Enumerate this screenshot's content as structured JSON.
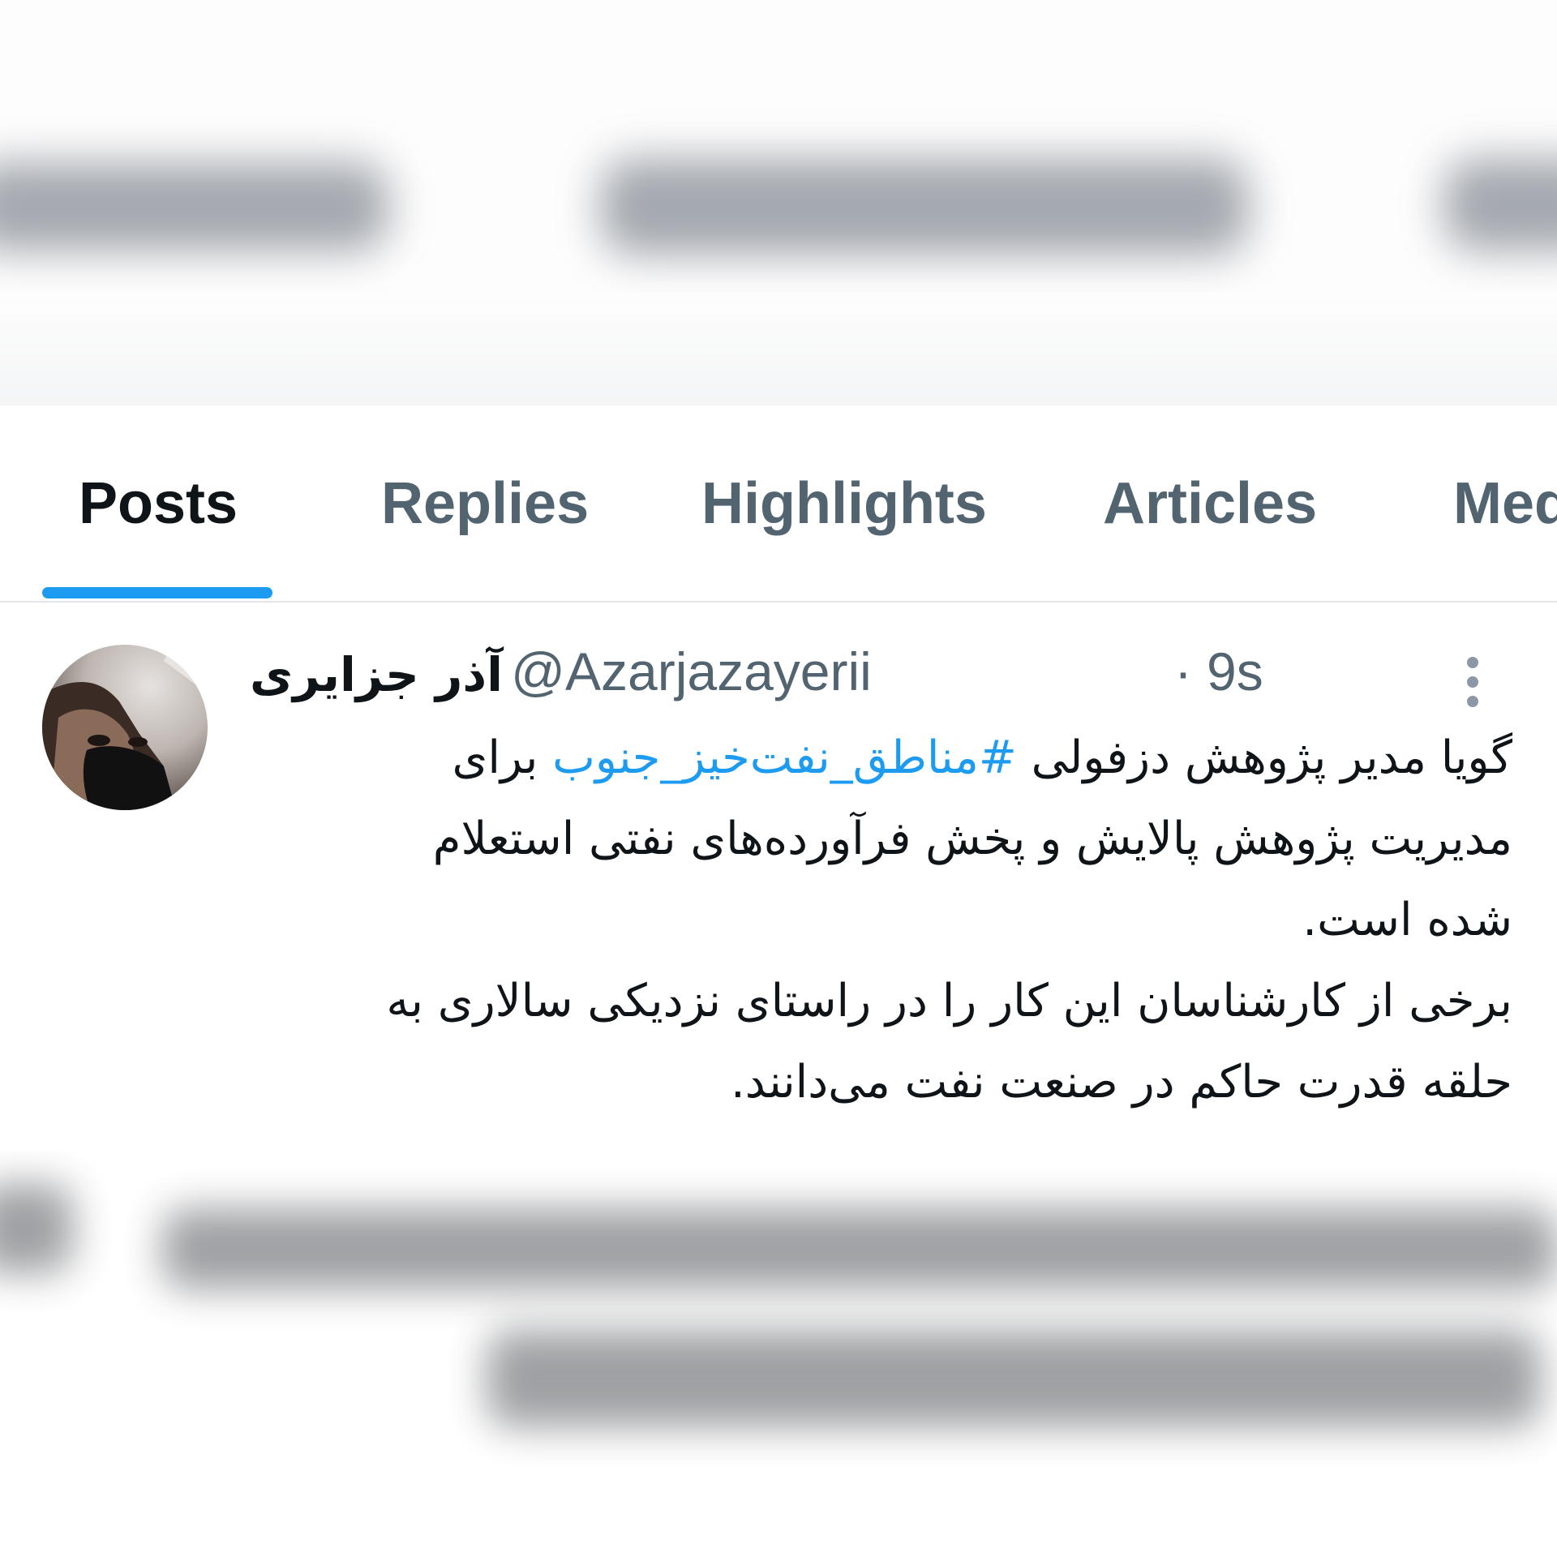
{
  "tabs": [
    {
      "label": "Posts",
      "active": true
    },
    {
      "label": "Replies",
      "active": false
    },
    {
      "label": "Highlights",
      "active": false
    },
    {
      "label": "Articles",
      "active": false
    },
    {
      "label": "Med",
      "active": false
    }
  ],
  "post": {
    "display_name": "آذر جزایری",
    "handle": "@Azarjazayerii",
    "separator": "·",
    "time": "9s",
    "text_lines": {
      "line1_before": "گویا مدیر پژوهش دزفولی ",
      "hashtag": "#مناطق_نفت‌خیز_جنوب",
      "line1_after": " برای",
      "line2": "مدیریت پژوهش پالایش و پخش فرآورده‌های نفتی استعلام",
      "line3": "شده است.",
      "line4": "برخی از کارشناسان این کار را در راستای نزدیکی سالاری به",
      "line5": "حلقه قدرت حاکم در صنعت نفت می‌دانند."
    }
  },
  "icons": {
    "more": "more-vertical-icon",
    "avatar": "avatar-photo"
  },
  "colors": {
    "accent": "#1d9bf0",
    "primary_text": "#0f1419",
    "secondary_text": "#536471",
    "divider": "#e3e6e9"
  }
}
